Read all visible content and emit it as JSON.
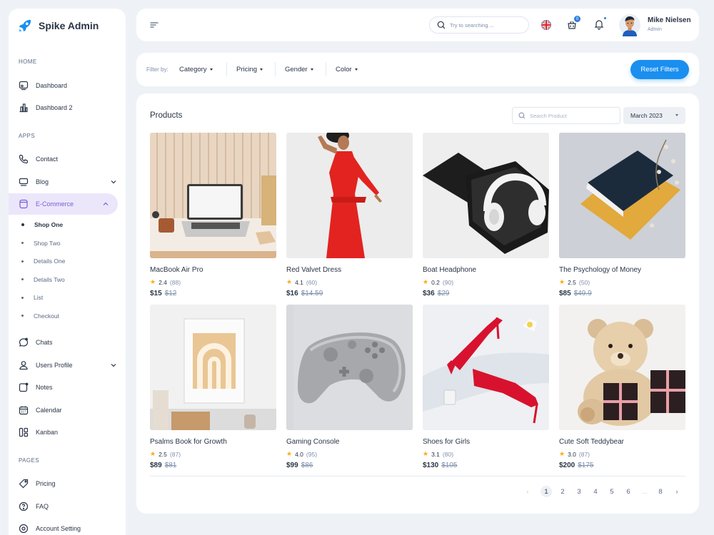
{
  "brand": {
    "name": "Spike Admin"
  },
  "sidebar": {
    "sections": {
      "home": "HOME",
      "apps": "APPS",
      "pages": "PAGES"
    },
    "home_items": [
      {
        "label": "Dashboard",
        "icon": "monitor-icon"
      },
      {
        "label": "Dashboard 2",
        "icon": "chart-bars-icon"
      }
    ],
    "app_items": [
      {
        "label": "Contact",
        "icon": "phone-icon"
      },
      {
        "label": "Blog",
        "icon": "chat-square-icon"
      },
      {
        "label": "E-Commerce",
        "icon": "shopping-bag-icon"
      }
    ],
    "ecommerce_sub": [
      "Shop One",
      "Shop Two",
      "Details One",
      "Details Two",
      "List",
      "Checkout"
    ],
    "more_apps": [
      {
        "label": "Chats",
        "icon": "chat-bubble-icon"
      },
      {
        "label": "Users Profile",
        "icon": "user-icon"
      },
      {
        "label": "Notes",
        "icon": "note-icon"
      },
      {
        "label": "Calendar",
        "icon": "calendar-icon"
      },
      {
        "label": "Kanban",
        "icon": "kanban-icon"
      }
    ],
    "page_items": [
      {
        "label": "Pricing",
        "icon": "price-tag-icon"
      },
      {
        "label": "FAQ",
        "icon": "help-circle-icon"
      },
      {
        "label": "Account Setting",
        "icon": "settings-icon"
      }
    ]
  },
  "header": {
    "search_placeholder": "Try to searching ...",
    "cart_count": "0",
    "user_name": "Mike Nielsen",
    "user_role": "Admin"
  },
  "filters": {
    "label": "Filter by:",
    "items": [
      "Category",
      "Pricing",
      "Gender",
      "Color"
    ],
    "reset_label": "Reset Filters"
  },
  "products_panel": {
    "title": "Products",
    "search_placeholder": "Search Product",
    "month": "March 2023"
  },
  "products": [
    {
      "name": "MacBook Air Pro",
      "rating": "2.4",
      "count": "(88)",
      "price": "$15",
      "old_price": "$12"
    },
    {
      "name": "Red Valvet Dress",
      "rating": "4.1",
      "count": "(60)",
      "price": "$16",
      "old_price": "$14.59"
    },
    {
      "name": "Boat Headphone",
      "rating": "0.2",
      "count": "(90)",
      "price": "$36",
      "old_price": "$29"
    },
    {
      "name": "The Psychology of Money",
      "rating": "2.5",
      "count": "(50)",
      "price": "$85",
      "old_price": "$49.9"
    },
    {
      "name": "Psalms Book for Growth",
      "rating": "2.5",
      "count": "(87)",
      "price": "$89",
      "old_price": "$81"
    },
    {
      "name": "Gaming Console",
      "rating": "4.0",
      "count": "(95)",
      "price": "$99",
      "old_price": "$86"
    },
    {
      "name": "Shoes for Girls",
      "rating": "3.1",
      "count": "(80)",
      "price": "$130",
      "old_price": "$105"
    },
    {
      "name": "Cute Soft Teddybear",
      "rating": "3.0",
      "count": "(87)",
      "price": "$200",
      "old_price": "$175"
    }
  ],
  "pagination": {
    "pages": [
      "1",
      "2",
      "3",
      "4",
      "5",
      "6",
      "...",
      "8"
    ],
    "current": "1"
  },
  "colors": {
    "accent": "#1a8ff0",
    "active_nav_bg": "#ece6fb",
    "active_nav_text": "#7a5cd6",
    "star": "#fbab14"
  }
}
